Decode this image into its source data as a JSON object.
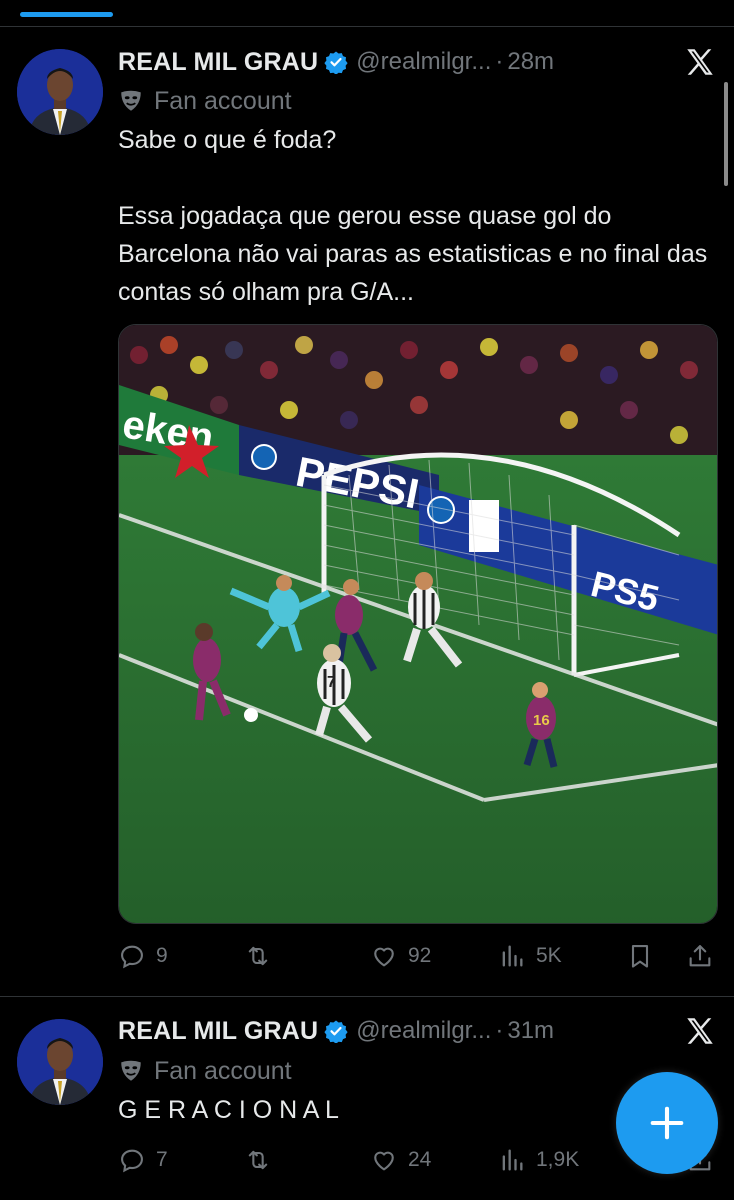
{
  "colors": {
    "accent": "#1d9bf0",
    "muted": "#71767b",
    "text": "#e7e9ea",
    "background": "#000000"
  },
  "tweets": [
    {
      "name": "REAL MIL GRAU",
      "handle": "@realmilgr...",
      "separator": "·",
      "time": "28m",
      "label": "Fan account",
      "text": "Sabe o que é foda?\n\nEssa jogadaça que gerou esse quase gol do Barcelona não vai paras as estatisticas e no final das contas só olham pra G/A...",
      "media": {
        "ad_boards": [
          "eken",
          "PEPSI",
          "PS5"
        ],
        "players": [
          "7",
          "16"
        ]
      },
      "stats": {
        "replies": "9",
        "retweets": "",
        "likes": "92",
        "views": "5K"
      }
    },
    {
      "name": "REAL MIL GRAU",
      "handle": "@realmilgr...",
      "separator": "·",
      "time": "31m",
      "label": "Fan account",
      "text": "G E R A C I O N A L",
      "stats": {
        "replies": "7",
        "retweets": "",
        "likes": "24",
        "views": "1,9K"
      }
    }
  ],
  "icons": [
    "verified-badge-icon",
    "x-logo-icon",
    "mask-icon",
    "reply-icon",
    "retweet-icon",
    "like-icon",
    "views-icon",
    "bookmark-icon",
    "share-icon",
    "plus-icon"
  ]
}
